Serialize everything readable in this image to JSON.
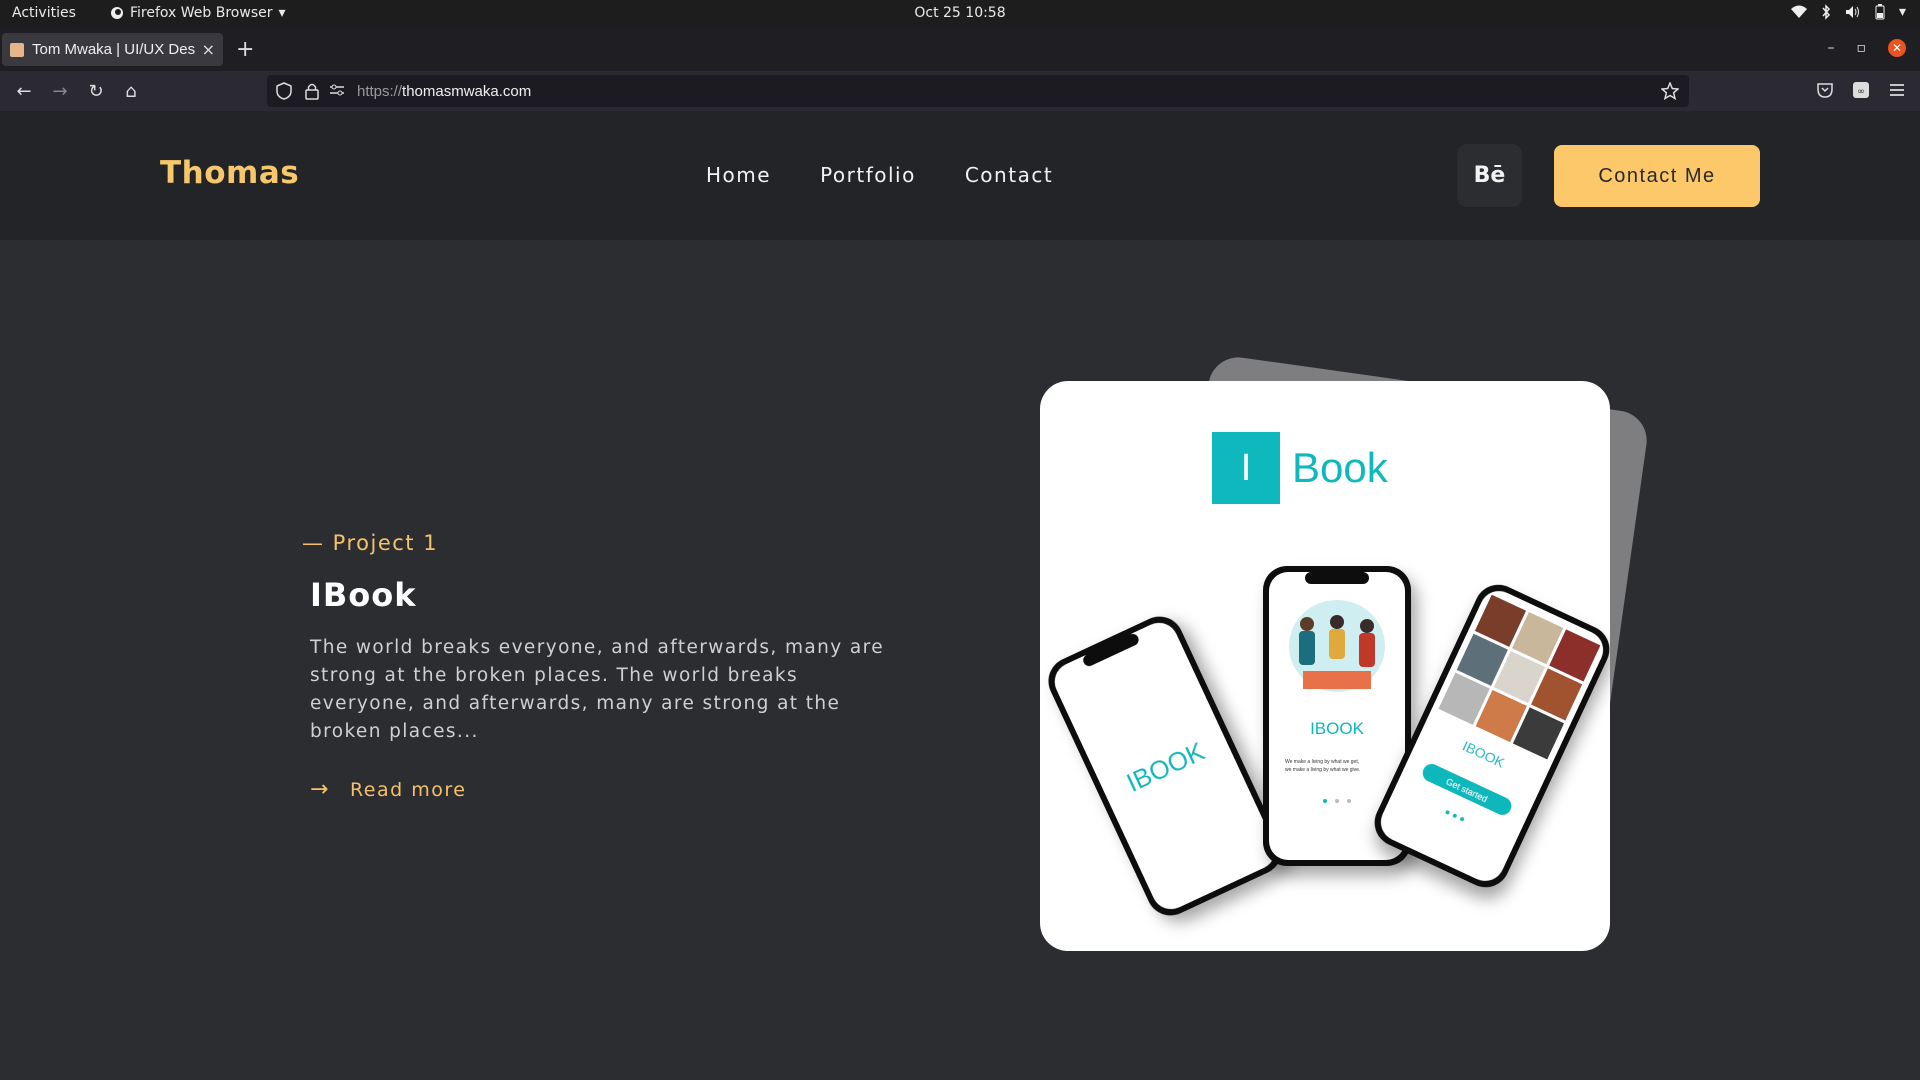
{
  "system_bar": {
    "activities": "Activities",
    "app_name": "Firefox Web Browser",
    "datetime": "Oct 25  10:58"
  },
  "browser": {
    "tab_title": "Tom Mwaka | UI/UX Design",
    "tab_close": "×",
    "new_tab": "+",
    "url_scheme": "https://",
    "url_host": "thomasmwaka.com"
  },
  "site": {
    "logo": "Thomas",
    "nav": [
      "Home",
      "Portfolio",
      "Contact"
    ],
    "behance_label": "Bē",
    "cta_label": "Contact Me"
  },
  "project": {
    "tag": "— Project 1",
    "title": "IBook",
    "description": "The world breaks everyone, and afterwards, many are strong at the broken places. The world breaks everyone, and afterwards, many are strong at the broken places...",
    "read_more": "Read more",
    "read_more_arrow": "→"
  },
  "mockup": {
    "logo_letter": "I",
    "logo_word": "Book",
    "phone1_text": "IBOOK",
    "phone2_text": "IBOOK",
    "phone2_small": "We make a living by what we get,",
    "phone2_small2": "we make a living by what we give.",
    "phone3_text": "IBOOK",
    "phone3_button": "Get started",
    "brand_color": "#0eb8bd"
  },
  "colors": {
    "accent": "#fcc86a",
    "page_bg": "#2c2d31",
    "header_bg": "#232428"
  }
}
